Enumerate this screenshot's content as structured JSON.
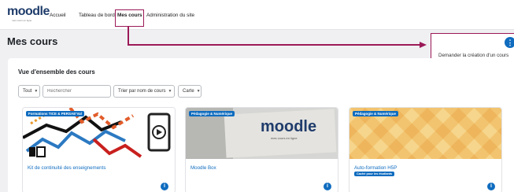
{
  "brand": {
    "name": "moodle",
    "tagline": "mes cours en ligne"
  },
  "nav": {
    "items": [
      "Accueil",
      "Tableau de bord",
      "Mes cours",
      "Administration du site"
    ],
    "active": "Mes cours"
  },
  "page": {
    "title": "Mes cours"
  },
  "actions_menu": {
    "icon": "kebab-icon",
    "item": "Demander la création d'un cours"
  },
  "overview": {
    "title": "Vue d'ensemble des cours",
    "filter": "Tout",
    "search_placeholder": "Rechercher",
    "sort": "Trier par nom de cours",
    "view": "Carte"
  },
  "courses": [
    {
      "category": "Formations TICE & PERSAE'Val",
      "name": "Kit de continuité des enseignements",
      "badge": ""
    },
    {
      "category": "Pédagogie & Numérique",
      "name": "Moodle Box",
      "badge": "",
      "image_text": "moodle",
      "image_subtext": "mes cours en ligne"
    },
    {
      "category": "Pédagogie & Numérique",
      "name": "Auto-formation H5P",
      "badge": "Caché pour les étudiants"
    }
  ],
  "colors": {
    "accent": "#0f6cbf",
    "highlight": "#9b1957",
    "brand": "#1f3c6b"
  }
}
